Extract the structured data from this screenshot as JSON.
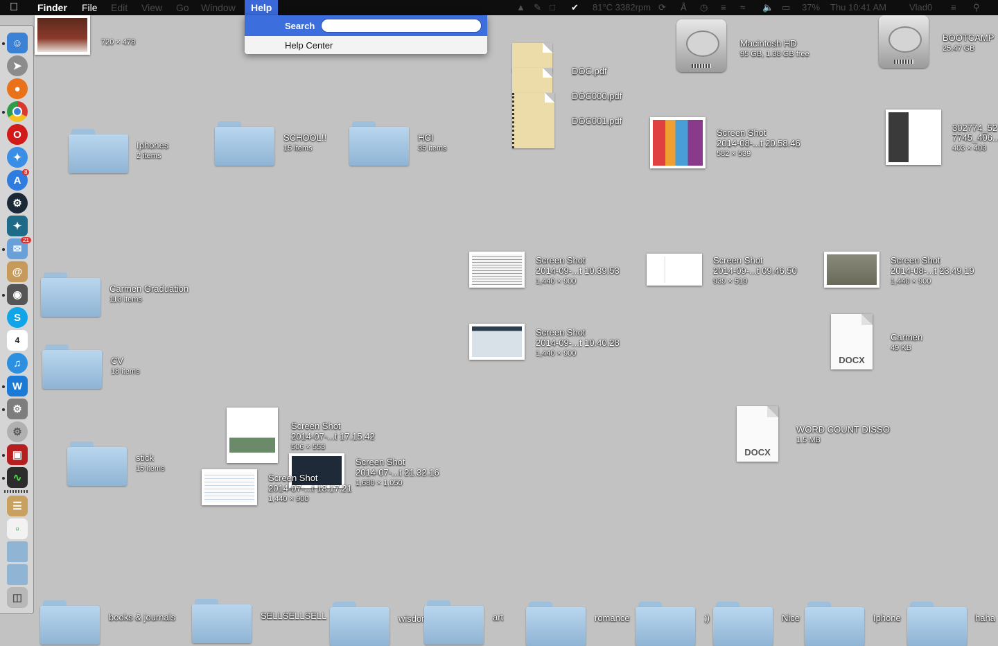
{
  "menubar": {
    "app_name": "Finder",
    "file": "File",
    "edit": "Edit",
    "view": "View",
    "go": "Go",
    "window": "Window",
    "help": "Help",
    "status_temp": "81°C 3382rpm",
    "battery": "37%",
    "clock": "Thu 10:41 AM",
    "user": "Vlad0"
  },
  "help_menu": {
    "search_label": "Search",
    "search_value": "",
    "help_center": "Help Center"
  },
  "dock": {
    "items": [
      {
        "icon": "finder-icon",
        "color": "#3b82d6"
      },
      {
        "icon": "launchpad-icon",
        "color": "#8c8c8c"
      },
      {
        "icon": "firefox-icon",
        "color": "#e8711a"
      },
      {
        "icon": "chrome-icon",
        "color": "#2e9d4a"
      },
      {
        "icon": "opera-icon",
        "color": "#d21a1a"
      },
      {
        "icon": "safari-icon",
        "color": "#3a8ee6"
      },
      {
        "icon": "app-store-icon",
        "color": "#2f7ce0"
      },
      {
        "icon": "steam-icon",
        "color": "#1b2838"
      },
      {
        "icon": "dreamweaver-icon",
        "color": "#1d6b86"
      },
      {
        "icon": "mail-icon",
        "color": "#6aa0d8"
      },
      {
        "icon": "contacts-icon",
        "color": "#c69a5a"
      },
      {
        "icon": "facetime-icon",
        "color": "#555555"
      },
      {
        "icon": "skype-icon",
        "color": "#10a5e8"
      },
      {
        "icon": "calendar-icon",
        "color": "#ffffff"
      },
      {
        "icon": "itunes-icon",
        "color": "#2d8fe0"
      },
      {
        "icon": "word-icon",
        "color": "#1a7ad6"
      },
      {
        "icon": "system-preferences-icon",
        "color": "#7d7d7d"
      },
      {
        "icon": "disk-utility-icon",
        "color": "#b0b0b0"
      },
      {
        "icon": "photo-booth-icon",
        "color": "#b51f1f"
      },
      {
        "icon": "activity-monitor-icon",
        "color": "#2c2c2c"
      },
      {
        "icon": "notes-icon",
        "color": "#c8a060"
      },
      {
        "icon": "document-icon",
        "color": "#f2f2f2"
      },
      {
        "icon": "folder-stack-icon",
        "color": "#8fb4d4"
      },
      {
        "icon": "downloads-stack-icon",
        "color": "#8fb4d4"
      },
      {
        "icon": "trash-icon",
        "color": "#b8b8b8"
      }
    ],
    "calendar_day": "4",
    "mail_badge": "21",
    "app_store_badge": "8"
  },
  "desktop": {
    "photo_top": {
      "sub": "720 × 478"
    },
    "folders": [
      {
        "name": "Iphones",
        "sub": "2 items"
      },
      {
        "name": "SCHOOL!!",
        "sub": "15 items"
      },
      {
        "name": "HCI",
        "sub": "35 items"
      },
      {
        "name": "Carmen Graduation",
        "sub": "113 items"
      },
      {
        "name": "CV",
        "sub": "18 items"
      },
      {
        "name": "stick",
        "sub": "15 items"
      }
    ],
    "pdfs": [
      {
        "name": "DOC.pdf"
      },
      {
        "name": "DOC000.pdf"
      },
      {
        "name": "DOC001.pdf"
      }
    ],
    "drives": [
      {
        "name": "Macintosh HD",
        "sub": "95 GB, 1.38 GB free"
      },
      {
        "name": "BOOTCAMP",
        "sub": "25.47 GB"
      }
    ],
    "screenshots": [
      {
        "line1": "Screen Shot",
        "line2": "2014-08-...t 20.58.46",
        "sub": "582 × 539"
      },
      {
        "line1": "302774_52",
        "line2": "7745_406...",
        "sub": "403 × 403"
      },
      {
        "line1": "Screen Shot",
        "line2": "2014-09-...t 10.39.53",
        "sub": "1,440 × 900"
      },
      {
        "line1": "Screen Shot",
        "line2": "2014-09-...t 09.46.50",
        "sub": "939 × 519"
      },
      {
        "line1": "Screen Shot",
        "line2": "2014-08-...t 23.49.19",
        "sub": "1,440 × 900"
      },
      {
        "line1": "Screen Shot",
        "line2": "2014-09-...t 10.40.28",
        "sub": "1,440 × 900"
      },
      {
        "line1": "Screen Shot",
        "line2": "2014-07-...t 17.15.42",
        "sub": "506 × 553"
      },
      {
        "line1": "Screen Shot",
        "line2": "2014-07-...t 21.32.16",
        "sub": "1,680 × 1,050"
      },
      {
        "line1": "Screen Shot",
        "line2": "2014-07-...t 18.17.21",
        "sub": "1,440 × 900"
      }
    ],
    "docx": [
      {
        "name": "Carmen",
        "sub": "49 KB",
        "type": "DOCX"
      },
      {
        "name": "WORD COUNT DISSO",
        "sub": "1.5 MB",
        "type": "DOCX"
      }
    ],
    "bottom_row": [
      "books & journals",
      "SELLSELLSELL",
      "wisdom",
      "art",
      "romance",
      ";)",
      "Nice",
      "Iphone",
      "haha"
    ]
  }
}
